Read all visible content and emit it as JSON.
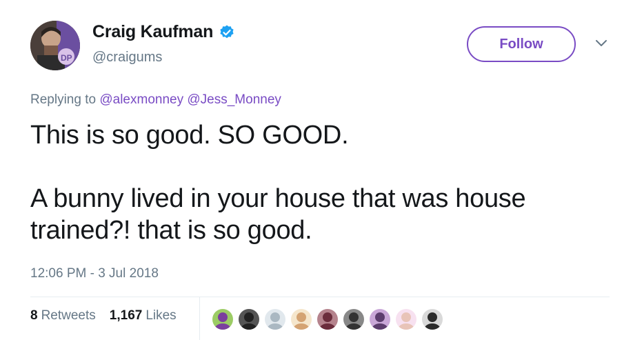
{
  "author": {
    "name": "Craig Kaufman",
    "handle": "@craigums",
    "avatar_icon": "profile-photo",
    "verified_icon": "verified-badge-icon"
  },
  "follow_label": "Follow",
  "reply": {
    "prefix": "Replying to",
    "mentions": [
      "@alexmonney",
      "@Jess_Monney"
    ]
  },
  "text": {
    "line1": "This is so good. SO GOOD.",
    "line2": "A bunny lived in your house that was house trained?! that is so good."
  },
  "timestamp": "12:06 PM - 3 Jul 2018",
  "stats": {
    "retweets_count": "8",
    "retweets_label": "Retweets",
    "likes_count": "1,167",
    "likes_label": "Likes"
  },
  "liker_avatars": [
    {
      "color": "#7b3f9e",
      "bg": "#9ccc65"
    },
    {
      "color": "#222222",
      "bg": "#555555"
    },
    {
      "color": "#aab8c2",
      "bg": "#e1e8ed"
    },
    {
      "color": "#d4a373",
      "bg": "#f5e6cc"
    },
    {
      "color": "#6b2d3c",
      "bg": "#b5838d"
    },
    {
      "color": "#333333",
      "bg": "#888888"
    },
    {
      "color": "#5c3d6e",
      "bg": "#c9a7d8"
    },
    {
      "color": "#e8c4b8",
      "bg": "#f7e1f0"
    },
    {
      "color": "#2b2b2b",
      "bg": "#d9d9d9"
    }
  ],
  "colors": {
    "accent": "#794bc4",
    "verified": "#1da1f2",
    "muted": "#657786",
    "text": "#14171a"
  }
}
